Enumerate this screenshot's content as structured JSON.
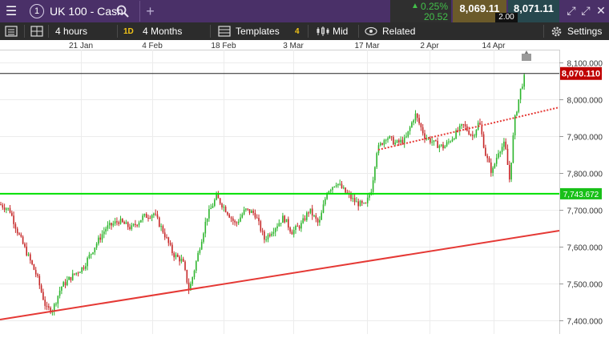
{
  "title_bar": {
    "instrument_number": "1",
    "instrument_name": "UK 100 - Cash",
    "change_percent": "0.25%",
    "change_points": "20.52",
    "sell_price": "8,069.11",
    "buy_price": "8,071.11",
    "spread": "2.00",
    "icons": [
      "menu-icon",
      "search-icon",
      "plus-icon",
      "move-icon",
      "maximize-icon",
      "close-icon"
    ]
  },
  "toolbar": {
    "interval": "4 hours",
    "period_badge": "1D",
    "period": "4 Months",
    "templates": "Templates",
    "templates_badge": "4",
    "price_type": "Mid",
    "related": "Related",
    "settings": "Settings"
  },
  "chart_data": {
    "type": "candlestick",
    "x_tick_labels": [
      "21 Jan",
      "4 Feb",
      "18 Feb",
      "3 Mar",
      "17 Mar",
      "2 Apr",
      "14 Apr"
    ],
    "y_tick_labels": [
      "8,100.000",
      "8,000.000",
      "7,900.000",
      "7,800.000",
      "7,700.000",
      "7,600.000",
      "7,500.000",
      "7,400.000"
    ],
    "y_ticks": [
      8100,
      8000,
      7900,
      7800,
      7700,
      7600,
      7500,
      7400
    ],
    "ylim": [
      7375,
      8135
    ],
    "current_price_label": "8,070.110",
    "current_price": 8070.11,
    "horizontal_level_label": "7,743.672",
    "horizontal_level": 7743.672,
    "grid": true,
    "colors": {
      "up": "#2db52d",
      "down": "#c62828",
      "support_line": "#00e000",
      "trend_line": "#e53935",
      "current_price_badge": "#c00000",
      "level_badge": "#18c018"
    }
  }
}
